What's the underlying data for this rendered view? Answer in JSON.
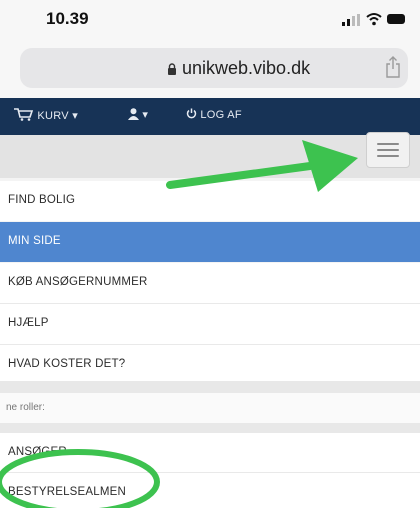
{
  "status_bar": {
    "time": "10.39"
  },
  "browser": {
    "url": "unikweb.vibo.dk"
  },
  "top_nav": {
    "cart_label": "KURV ▾",
    "user_label": "▾",
    "logout_label": "LOG AF"
  },
  "menu": {
    "items": [
      {
        "label": "FIND BOLIG",
        "active": false
      },
      {
        "label": "MIN SIDE",
        "active": true
      },
      {
        "label": "KØB ANSØGERNUMMER",
        "active": false
      },
      {
        "label": "HJÆLP",
        "active": false
      },
      {
        "label": "HVAD KOSTER DET?",
        "active": false
      }
    ],
    "roles_label": "ne roller:",
    "role_items": [
      {
        "label": "ANSØGER"
      },
      {
        "label": "BESTYRELSEALMEN"
      }
    ]
  },
  "colors": {
    "nav_bg": "#173356",
    "active_bg": "#4f86cf",
    "annotation_green": "#3dc24f"
  },
  "icons": [
    "signal-icon",
    "wifi-icon",
    "battery-icon",
    "lock-icon",
    "share-icon",
    "cart-icon",
    "user-icon",
    "power-icon",
    "hamburger-icon"
  ]
}
